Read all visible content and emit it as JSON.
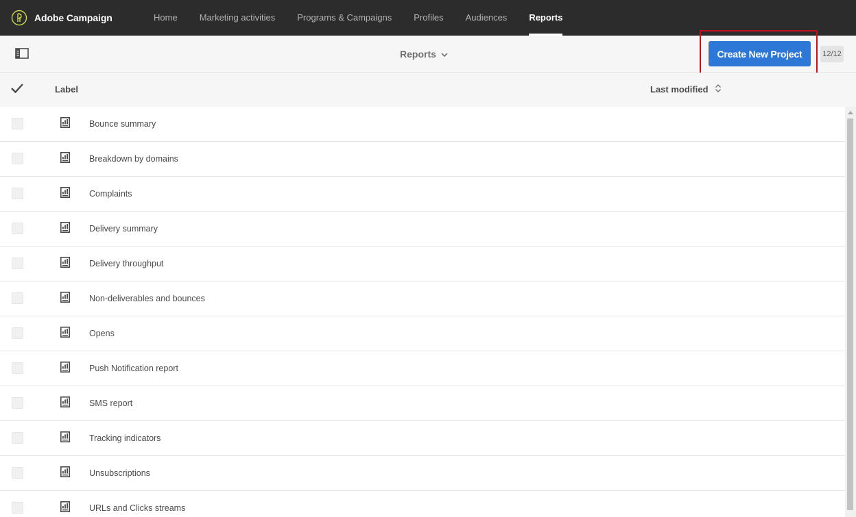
{
  "app": {
    "name": "Adobe Campaign",
    "logo_icon": "adobe-campaign-logo-icon"
  },
  "nav": {
    "items": [
      {
        "label": "Home",
        "active": false
      },
      {
        "label": "Marketing activities",
        "active": false
      },
      {
        "label": "Programs & Campaigns",
        "active": false
      },
      {
        "label": "Profiles",
        "active": false
      },
      {
        "label": "Audiences",
        "active": false
      },
      {
        "label": "Reports",
        "active": true
      }
    ]
  },
  "toolbar": {
    "panel_toggle_icon": "side-panel-icon",
    "title": "Reports",
    "title_icon": "chevron-down-icon",
    "create_button_label": "Create New Project",
    "count": "12/12"
  },
  "table": {
    "columns": {
      "label": "Label",
      "last_modified": "Last modified"
    },
    "select_all_icon": "checkmark-icon",
    "sort_icon": "sort-icon",
    "row_icon": "report-icon",
    "rows": [
      {
        "label": "Bounce summary"
      },
      {
        "label": "Breakdown by domains"
      },
      {
        "label": "Complaints"
      },
      {
        "label": "Delivery summary"
      },
      {
        "label": "Delivery throughput"
      },
      {
        "label": "Non-deliverables and bounces"
      },
      {
        "label": "Opens"
      },
      {
        "label": "Push Notification report"
      },
      {
        "label": "SMS report"
      },
      {
        "label": "Tracking indicators"
      },
      {
        "label": "Unsubscriptions"
      },
      {
        "label": "URLs and Clicks streams"
      }
    ]
  },
  "colors": {
    "topbar": "#2c2c2c",
    "accent_button": "#2d78d7",
    "highlight_border": "#c4121c",
    "logo_yellow": "#cbd64a"
  }
}
